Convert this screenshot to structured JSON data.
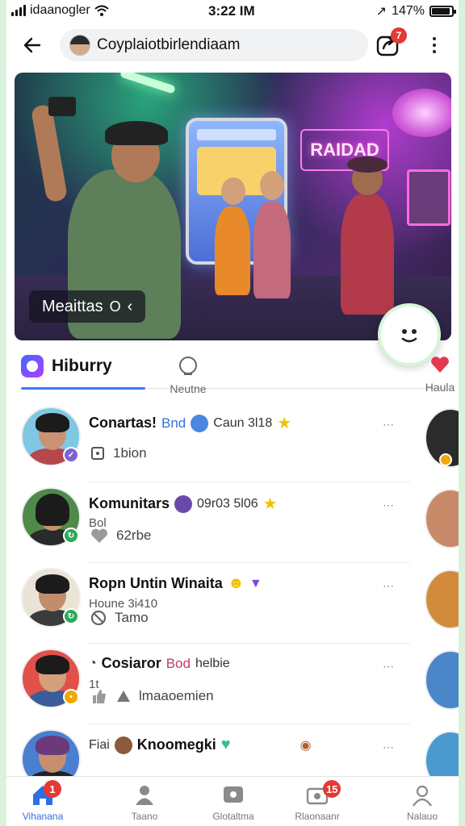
{
  "status_bar": {
    "carrier": "idaanogler",
    "time": "3:22 IM",
    "battery_text": "147%"
  },
  "top_bar": {
    "title": "Coyplaiotbirlendiaam",
    "share_badge": "7"
  },
  "hero": {
    "sign_text": "RAIDAD",
    "label": "Meaittas",
    "label_suffix": "O"
  },
  "tabs": [
    {
      "label": "Hiburry",
      "active": true
    },
    {
      "label": "Neutne",
      "active": false
    },
    {
      "label": "Haula",
      "active": false
    }
  ],
  "list": [
    {
      "name": "Conartas!",
      "accent": "Bnd",
      "meta": "Caun 3l18",
      "sub": "",
      "action_icon": "square-icon",
      "action_text": "1bion",
      "more": "⋯"
    },
    {
      "name": "Komunitars",
      "accent": "",
      "meta": "09r03 5l06",
      "sub": "Bol",
      "action_icon": "heart-icon",
      "action_text": "62rbe",
      "more": "⋯"
    },
    {
      "name": "Ropn Untin Winaita",
      "accent": "",
      "meta": "",
      "sub": "Houne 3i410",
      "action_icon": "no-icon",
      "action_text": "Tamo",
      "more": "⋯"
    },
    {
      "name": "Cosiaror",
      "accent": "Bod",
      "meta": "helbie",
      "sub": "1t",
      "action_icon": "like-icon",
      "action_text": "lmaaoemien",
      "more": "⋯"
    },
    {
      "name": "Fiai",
      "accent": "",
      "meta": "Knoomegki",
      "sub": "",
      "action_icon": "",
      "action_text": "",
      "more": "⋯"
    }
  ],
  "bottom_nav": [
    {
      "label": "Vihanana",
      "icon": "home-icon",
      "badge": "1",
      "active": true
    },
    {
      "label": "Taano",
      "icon": "person-icon",
      "badge": "",
      "active": false
    },
    {
      "label": "Glotaltma",
      "icon": "chat-icon",
      "badge": "",
      "active": false
    },
    {
      "label": "Rlaonaanr",
      "icon": "camera-icon",
      "badge": "15",
      "active": false
    },
    {
      "label": "Nalauo",
      "icon": "profile-icon",
      "badge": "",
      "active": false
    }
  ],
  "colors": {
    "accent": "#3a7bfd",
    "badge": "#e53935",
    "background_edge": "#d9f2dc"
  }
}
